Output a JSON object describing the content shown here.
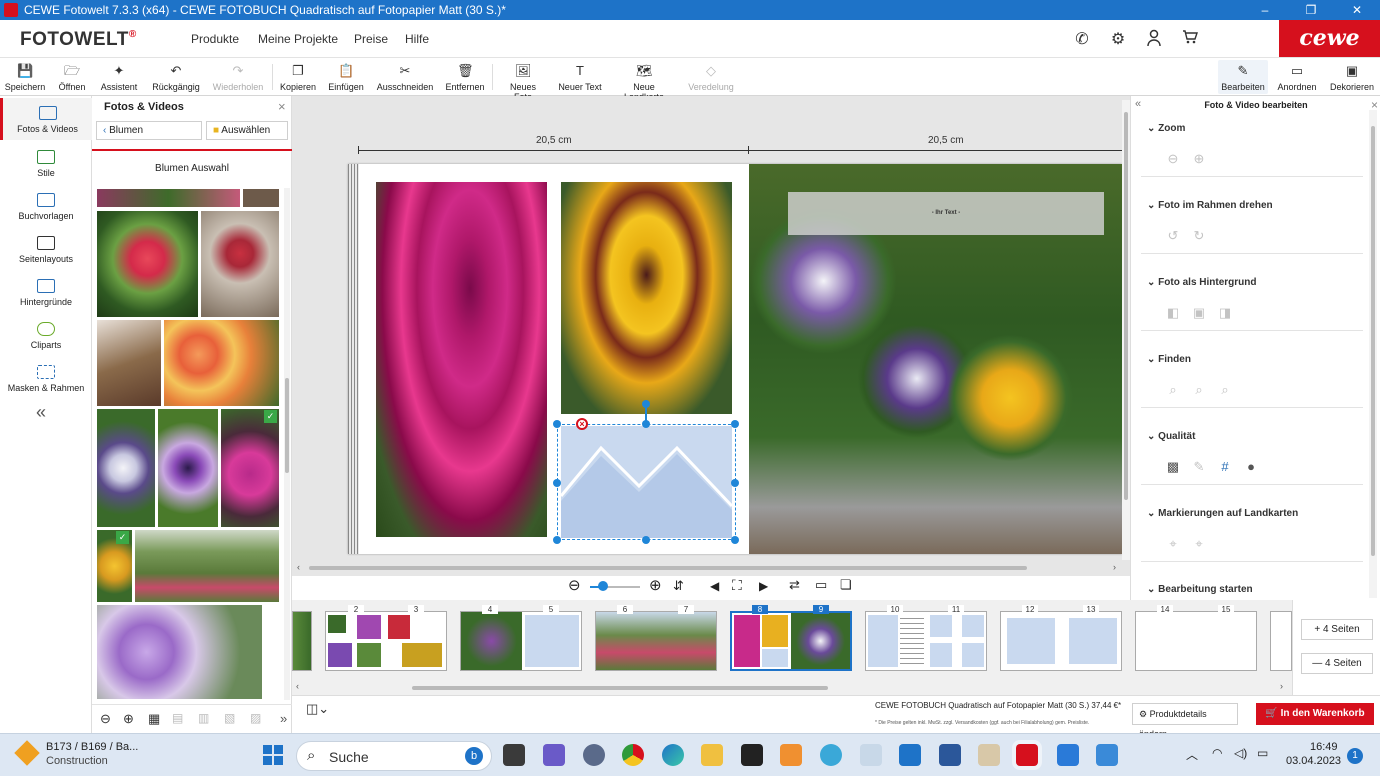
{
  "window": {
    "title": "CEWE Fotowelt 7.3.3 (x64) - CEWE FOTOBUCH Quadratisch auf Fotopapier Matt (30 S.)*",
    "minimize": "–",
    "maximize": "❐",
    "close": "✕"
  },
  "brand": {
    "logo": "FOTOWELT",
    "logo_mark": "®",
    "cewe": "cewe",
    "accent": "#d6101d",
    "blue": "#1e73c8"
  },
  "nav": [
    "Produkte",
    "Meine Projekte",
    "Preise",
    "Hilfe"
  ],
  "toolbar": {
    "speichern": "Speichern",
    "oeffnen": "Öffnen",
    "assistent": "Assistent",
    "rueckgaengig": "Rückgängig",
    "wiederholen": "Wiederholen",
    "kopieren": "Kopieren",
    "einfuegen": "Einfügen",
    "ausschneiden": "Ausschneiden",
    "entfernen": "Entfernen",
    "neues_foto": "Neues Foto",
    "neuer_text": "Neuer Text",
    "neue_landkarte": "Neue Landkarte",
    "veredelung": "Veredelung",
    "bearbeiten": "Bearbeiten",
    "anordnen": "Anordnen",
    "dekorieren": "Dekorieren"
  },
  "rail": [
    "Fotos & Videos",
    "Stile",
    "Buchvorlagen",
    "Seitenlayouts",
    "Hintergründe",
    "Cliparts",
    "Masken & Rahmen"
  ],
  "rail_collapse": "«",
  "library": {
    "title": "Fotos & Videos",
    "back": "Blumen",
    "select": "Auswählen",
    "album": "Blumen Auswahl",
    "close": "×"
  },
  "canvas": {
    "ruler_left": "20,5 cm",
    "ruler_right": "20,5 cm",
    "text_placeholder": "- Ihr Text -"
  },
  "rpanel": {
    "title": "Foto & Video bearbeiten",
    "sections": [
      "Zoom",
      "Foto im Rahmen drehen",
      "Foto als Hintergrund",
      "Finden",
      "Qualität",
      "Markierungen auf Landkarten",
      "Bearbeitung starten"
    ]
  },
  "pages": [
    {
      "left": "2",
      "right": "3"
    },
    {
      "left": "4",
      "right": "5"
    },
    {
      "left": "6",
      "right": "7"
    },
    {
      "left": "8",
      "right": "9",
      "selected": true
    },
    {
      "left": "10",
      "right": "11"
    },
    {
      "left": "12",
      "right": "13"
    },
    {
      "left": "14",
      "right": "15"
    }
  ],
  "strip_controls": {
    "add": "+ 4 Seiten",
    "remove": "— 4 Seiten"
  },
  "status": {
    "product": "CEWE FOTOBUCH Quadratisch auf Fotopapier Matt (30 S.) 37,44 €*",
    "note": "* Die Preise gelten inkl. MwSt. zzgl. Versandkosten (ggf. auch bei Filialabholung) gem. Preisliste.",
    "details": "Produktdetails ändern",
    "cart": "In den Warenkorb"
  },
  "taskbar": {
    "weather_title": "B173 / B169 / Ba...",
    "weather_sub": "Construction",
    "search": "Suche",
    "time": "16:49",
    "date": "03.04.2023",
    "notif": "1"
  }
}
